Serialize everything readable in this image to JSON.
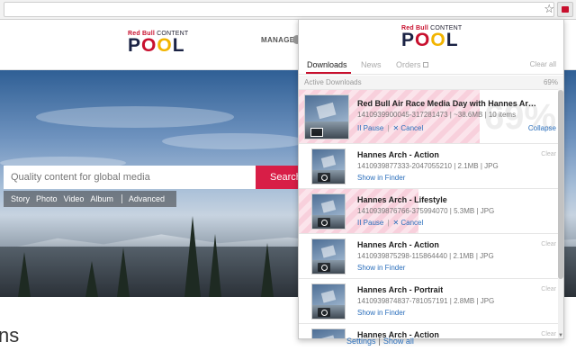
{
  "browser": {
    "star_icon": "star-outline-icon",
    "extension_icon": "redbull-content-pool-extension-icon"
  },
  "page": {
    "logo": {
      "brand": "Red Bull",
      "content": "CONTENT",
      "pool": "POOL"
    },
    "manage_label": "MANAGE",
    "search": {
      "placeholder": "Quality content for global media",
      "button": "Search"
    },
    "filters": [
      "Story",
      "Photo",
      "Video",
      "Album"
    ],
    "advanced": "Advanced",
    "heading_fragment": "ns"
  },
  "popup": {
    "logo": {
      "brand": "Red Bull",
      "content": "CONTENT",
      "pool": "POOL"
    },
    "tabs": [
      {
        "label": "Downloads",
        "active": true
      },
      {
        "label": "News",
        "active": false
      },
      {
        "label": "Orders",
        "active": false
      }
    ],
    "clear_all": "Clear all",
    "section": {
      "label": "Active Downloads",
      "percent": "69%"
    },
    "downloads": [
      {
        "title": "Red Bull Air Race Media Day with Hannes Arch...",
        "meta": "1410939900045-317281473 | ~38.6MB | 10 items",
        "action1": "II Pause",
        "action2": "✕ Cancel",
        "right": "Collapse",
        "bg_percent": "69%",
        "progress": 0.68,
        "kind": "album"
      },
      {
        "title": "Hannes Arch - Action",
        "meta": "1410939877333-2047055210 | 2.1MB | JPG",
        "action1": "Show in Finder",
        "right": "Clear",
        "progress": 0,
        "kind": "photo"
      },
      {
        "title": "Hannes Arch - Lifestyle",
        "meta": "1410939876766-375994070 | 5.3MB | JPG",
        "action1": "II Pause",
        "action2": "✕ Cancel",
        "progress": 0.45,
        "kind": "photo"
      },
      {
        "title": "Hannes Arch - Action",
        "meta": "1410939875298-115864440 | 2.1MB | JPG",
        "action1": "Show in Finder",
        "right": "Clear",
        "progress": 0,
        "kind": "photo"
      },
      {
        "title": "Hannes Arch - Portrait",
        "meta": "1410939874837-781057191 | 2.8MB | JPG",
        "action1": "Show in Finder",
        "right": "Clear",
        "progress": 0,
        "kind": "photo"
      },
      {
        "title": "Hannes Arch - Action",
        "meta": "",
        "right": "Clear",
        "progress": 0,
        "kind": "photo"
      }
    ],
    "footer": {
      "settings": "Settings",
      "show_all": "Show all"
    }
  }
}
